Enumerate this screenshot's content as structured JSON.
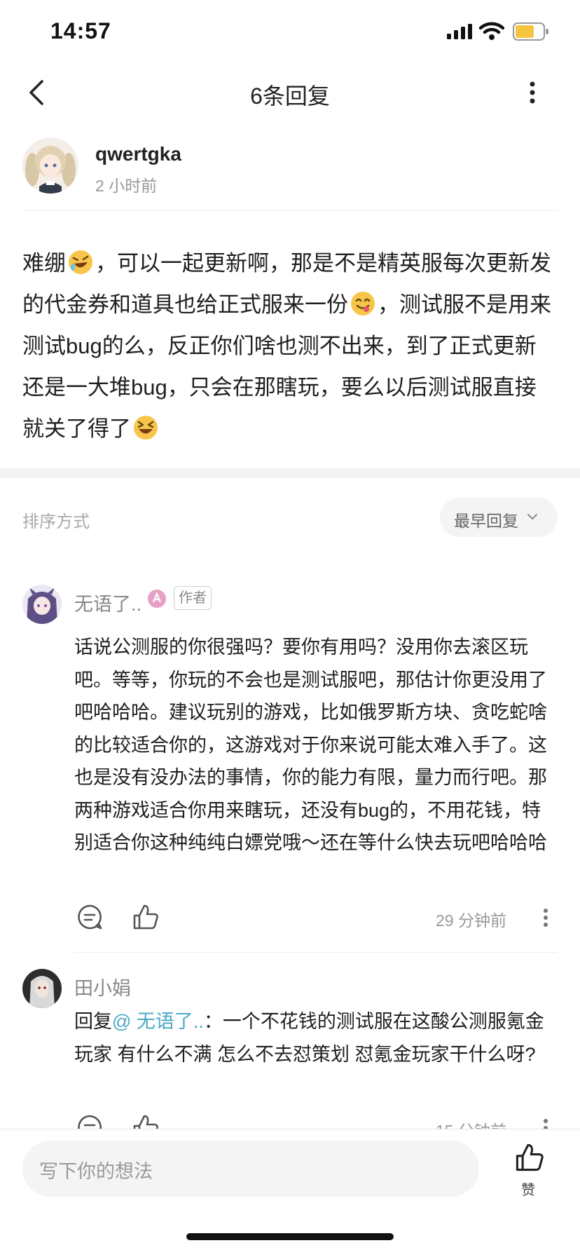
{
  "status_bar": {
    "time": "14:57"
  },
  "nav": {
    "title": "6条回复"
  },
  "post": {
    "username": "qwertgka",
    "time": "2 小时前",
    "text_parts": [
      "难绷",
      "，可以一起更新啊，那是不是精英服每次更新发的代金券和道具也给正式服来一份",
      "，测试服不是用来测试bug的么，反正你们啥也测不出来，到了正式更新还是一大堆bug，只会在那瞎玩，要么以后测试服直接就关了得了"
    ],
    "emojis": [
      "rofl-emoji",
      "yum-emoji",
      "grin-squint-emoji"
    ]
  },
  "sort": {
    "label": "排序方式",
    "selected": "最早回复"
  },
  "replies": [
    {
      "name": "无语了..",
      "tag": "作者",
      "text": "话说公测服的你很强吗？要你有用吗？没用你去滚区玩吧。等等，你玩的不会也是测试服吧，那估计你更没用了吧哈哈哈。建议玩别的游戏，比如俄罗斯方块、贪吃蛇啥的比较适合你的，这游戏对于你来说可能太难入手了。这也是没有没办法的事情，你的能力有限，量力而行吧。那两种游戏适合你用来瞎玩，还没有bug的，不用花钱，特别适合你这种纯纯白嫖党哦～还在等什么快去玩吧哈哈哈",
      "time": "29 分钟前"
    },
    {
      "name": "田小娟",
      "reply_prefix": "回复",
      "mention": "@ 无语了..",
      "text": "：一个不花钱的测试服在这酸公测服氪金玩家 有什么不满 怎么不去怼策划 怼氪金玩家干什么呀?",
      "time": "15 分钟前"
    }
  ],
  "bottom": {
    "placeholder": "写下你的想法",
    "like_label": "赞"
  },
  "colors": {
    "mention": "#4aa8c6",
    "battery": "#f5c542",
    "badge": "#e6a0c4"
  }
}
